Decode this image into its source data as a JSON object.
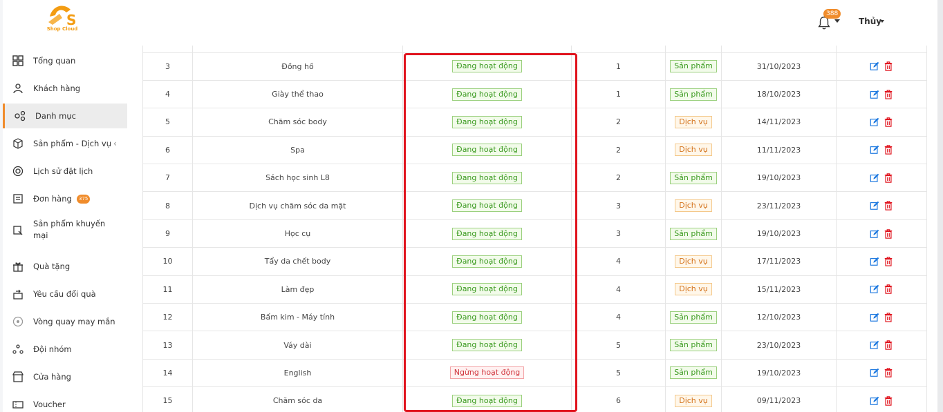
{
  "brand": {
    "name": "Shop Cloud",
    "color": "#f39c12"
  },
  "header": {
    "notification_count": "388",
    "user_name": "Thủy"
  },
  "sidebar": {
    "items": [
      {
        "label": "Tổng quan",
        "icon": "grid-icon"
      },
      {
        "label": "Khách hàng",
        "icon": "users-icon"
      },
      {
        "label": "Danh mục",
        "icon": "category-icon",
        "active": true
      },
      {
        "label": "Sản phẩm - Dịch vụ",
        "icon": "box-icon"
      },
      {
        "label": "Lịch sử đặt lịch",
        "icon": "history-icon"
      },
      {
        "label": "Đơn hàng",
        "icon": "order-icon",
        "badge": "375"
      },
      {
        "label": "Sản phẩm khuyến mại",
        "icon": "promo-icon"
      },
      {
        "label": "Quà tặng",
        "icon": "gift-icon"
      },
      {
        "label": "Yêu cầu đổi quà",
        "icon": "exchange-icon"
      },
      {
        "label": "Vòng quay may mắn",
        "icon": "wheel-icon"
      },
      {
        "label": "Đội nhóm",
        "icon": "team-icon"
      },
      {
        "label": "Cửa hàng",
        "icon": "store-icon"
      },
      {
        "label": "Voucher",
        "icon": "voucher-icon"
      }
    ]
  },
  "table": {
    "rows": [
      {
        "no": "3",
        "name": "Đồng hồ",
        "status": "Đang hoạt động",
        "status_type": "active",
        "order": "1",
        "type": "Sản phẩm",
        "type_kind": "product",
        "date": "31/10/2023"
      },
      {
        "no": "4",
        "name": "Giày thể thao",
        "status": "Đang hoạt động",
        "status_type": "active",
        "order": "1",
        "type": "Sản phẩm",
        "type_kind": "product",
        "date": "18/10/2023"
      },
      {
        "no": "5",
        "name": "Chăm sóc body",
        "status": "Đang hoạt động",
        "status_type": "active",
        "order": "2",
        "type": "Dịch vụ",
        "type_kind": "service",
        "date": "14/11/2023"
      },
      {
        "no": "6",
        "name": "Spa",
        "status": "Đang hoạt động",
        "status_type": "active",
        "order": "2",
        "type": "Dịch vụ",
        "type_kind": "service",
        "date": "11/11/2023"
      },
      {
        "no": "7",
        "name": "Sách học sinh L8",
        "status": "Đang hoạt động",
        "status_type": "active",
        "order": "2",
        "type": "Sản phẩm",
        "type_kind": "product",
        "date": "19/10/2023"
      },
      {
        "no": "8",
        "name": "Dịch vụ chăm sóc da mặt",
        "status": "Đang hoạt động",
        "status_type": "active",
        "order": "3",
        "type": "Dịch vụ",
        "type_kind": "service",
        "date": "23/11/2023"
      },
      {
        "no": "9",
        "name": "Học cụ",
        "status": "Đang hoạt động",
        "status_type": "active",
        "order": "3",
        "type": "Sản phẩm",
        "type_kind": "product",
        "date": "19/10/2023"
      },
      {
        "no": "10",
        "name": "Tẩy da chết body",
        "status": "Đang hoạt động",
        "status_type": "active",
        "order": "4",
        "type": "Dịch vụ",
        "type_kind": "service",
        "date": "17/11/2023"
      },
      {
        "no": "11",
        "name": "Làm đẹp",
        "status": "Đang hoạt động",
        "status_type": "active",
        "order": "4",
        "type": "Dịch vụ",
        "type_kind": "service",
        "date": "15/11/2023"
      },
      {
        "no": "12",
        "name": "Bấm kim - Máy tính",
        "status": "Đang hoạt động",
        "status_type": "active",
        "order": "4",
        "type": "Sản phẩm",
        "type_kind": "product",
        "date": "12/10/2023"
      },
      {
        "no": "13",
        "name": "Váy dài",
        "status": "Đang hoạt động",
        "status_type": "active",
        "order": "5",
        "type": "Sản phẩm",
        "type_kind": "product",
        "date": "23/10/2023"
      },
      {
        "no": "14",
        "name": "English",
        "status": "Ngừng hoạt động",
        "status_type": "inactive",
        "order": "5",
        "type": "Sản phẩm",
        "type_kind": "product",
        "date": "19/10/2023"
      },
      {
        "no": "15",
        "name": "Chăm sóc da",
        "status": "Đang hoạt động",
        "status_type": "active",
        "order": "6",
        "type": "Dịch vụ",
        "type_kind": "service",
        "date": "09/11/2023"
      }
    ],
    "edit_icon": "edit-icon",
    "delete_icon": "trash-icon",
    "edit_color": "#1f7ae0",
    "delete_color": "#e0131d"
  },
  "highlight_color": "#e0131d"
}
